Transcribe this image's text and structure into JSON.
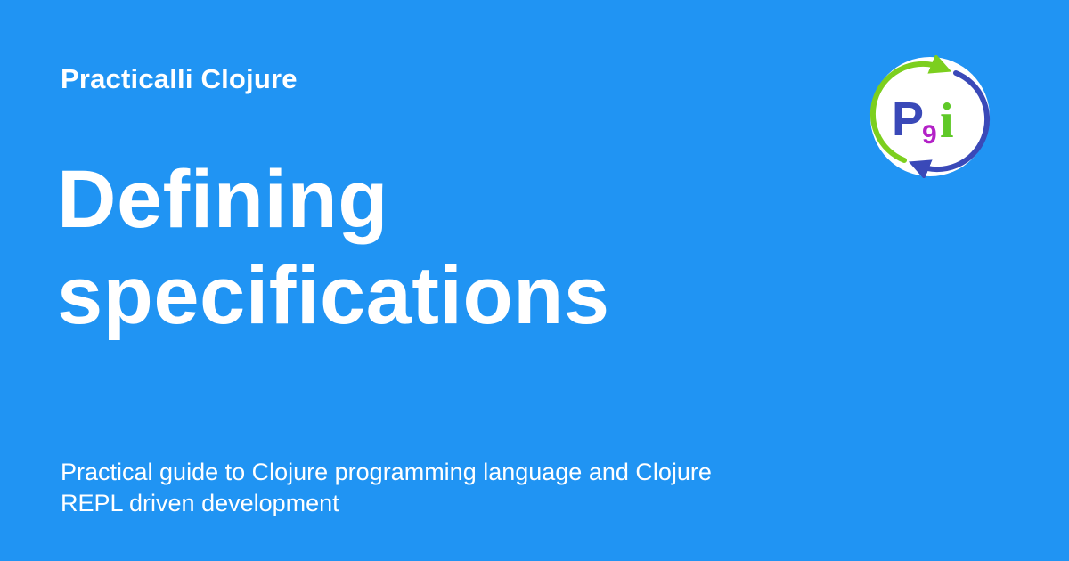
{
  "site": {
    "name": "Practicalli Clojure"
  },
  "page": {
    "title": "Defining specifications",
    "description": "Practical guide to Clojure programming language and Clojure REPL driven development"
  },
  "logo": {
    "icon": "practicalli-logo-icon",
    "letters": "P9i",
    "colors": {
      "ring": "#ffffff",
      "arrow_green": "#7ccf1e",
      "arrow_blue": "#3a49b8",
      "letter_p": "#3a49b8",
      "digit_9": "#b321c7",
      "letter_i": "#5fc928"
    }
  },
  "theme": {
    "background": "#2094f3",
    "text": "#ffffff"
  }
}
